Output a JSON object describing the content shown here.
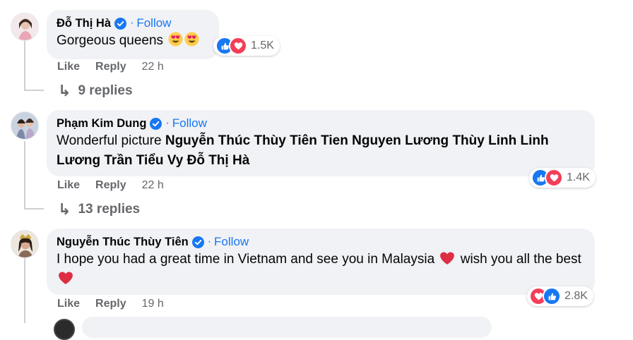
{
  "comments": [
    {
      "author": "Đỗ Thị Hà",
      "follow_label": "Follow",
      "text": "Gorgeous queens",
      "reaction_count": "1.5K",
      "like_label": "Like",
      "reply_label": "Reply",
      "time": "22 h",
      "replies_label": "9 replies"
    },
    {
      "author": "Phạm Kim Dung",
      "follow_label": "Follow",
      "text_prefix": "Wonderful picture",
      "tags": [
        "Nguyễn Thúc Thùy Tiên",
        "Tien Nguyen",
        "Lương Thùy Linh",
        "Linh Lương",
        "Trần Tiểu Vy",
        "Đỗ Thị Hà"
      ],
      "reaction_count": "1.4K",
      "like_label": "Like",
      "reply_label": "Reply",
      "time": "22 h",
      "replies_label": "13 replies"
    },
    {
      "author": "Nguyễn Thúc Thùy Tiên",
      "follow_label": "Follow",
      "text_part1": "I hope you had a great time in Vietnam and see you in Malaysia",
      "text_part2": "wish you all the",
      "text_part3": "best",
      "reaction_count": "2.8K",
      "like_label": "Like",
      "reply_label": "Reply",
      "time": "19 h"
    }
  ],
  "colors": {
    "accent": "#1877f2",
    "love": "#f33e58",
    "bubble": "#f0f2f5",
    "muted": "#65676b"
  }
}
